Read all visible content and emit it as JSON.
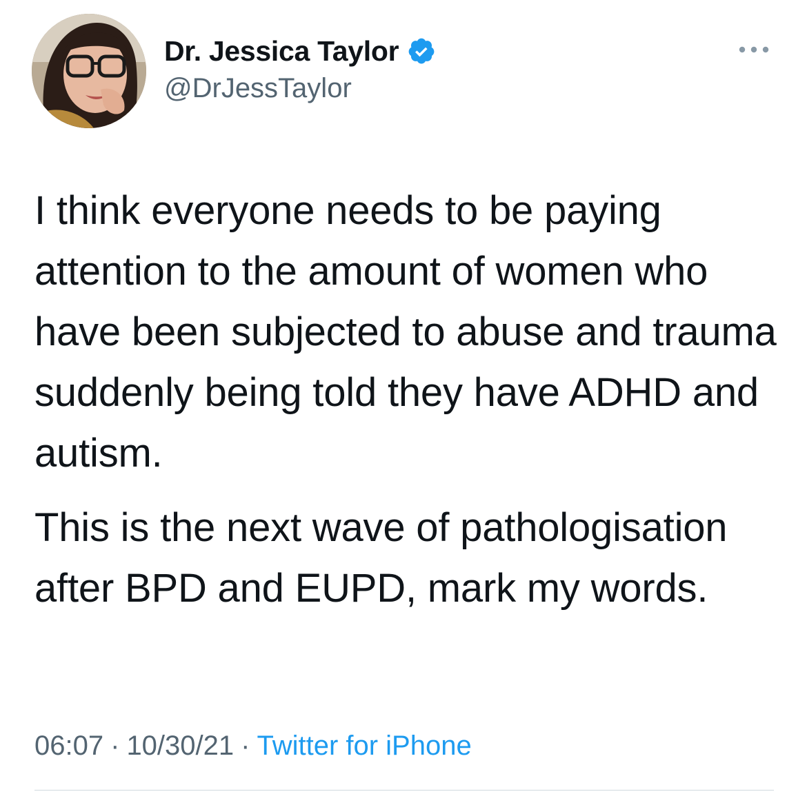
{
  "author": {
    "display_name": "Dr. Jessica Taylor",
    "handle": "@DrJessTaylor",
    "verified": true,
    "avatar_icon": "profile-photo"
  },
  "tweet": {
    "paragraphs": [
      "I think everyone needs to be paying attention to the amount of women who have been subjected to abuse and trauma suddenly being told they have ADHD and autism.",
      "This is the next wave of pathologisation after BPD and EUPD, mark my words."
    ],
    "time": "06:07",
    "date": "10/30/21",
    "separator": "·",
    "source": "Twitter for iPhone"
  },
  "icons": {
    "verified": "verified-badge-icon",
    "more": "more-options-icon"
  },
  "colors": {
    "text": "#0f1419",
    "secondary": "#536471",
    "accent": "#1d9bf0",
    "divider": "#cfd9de"
  }
}
